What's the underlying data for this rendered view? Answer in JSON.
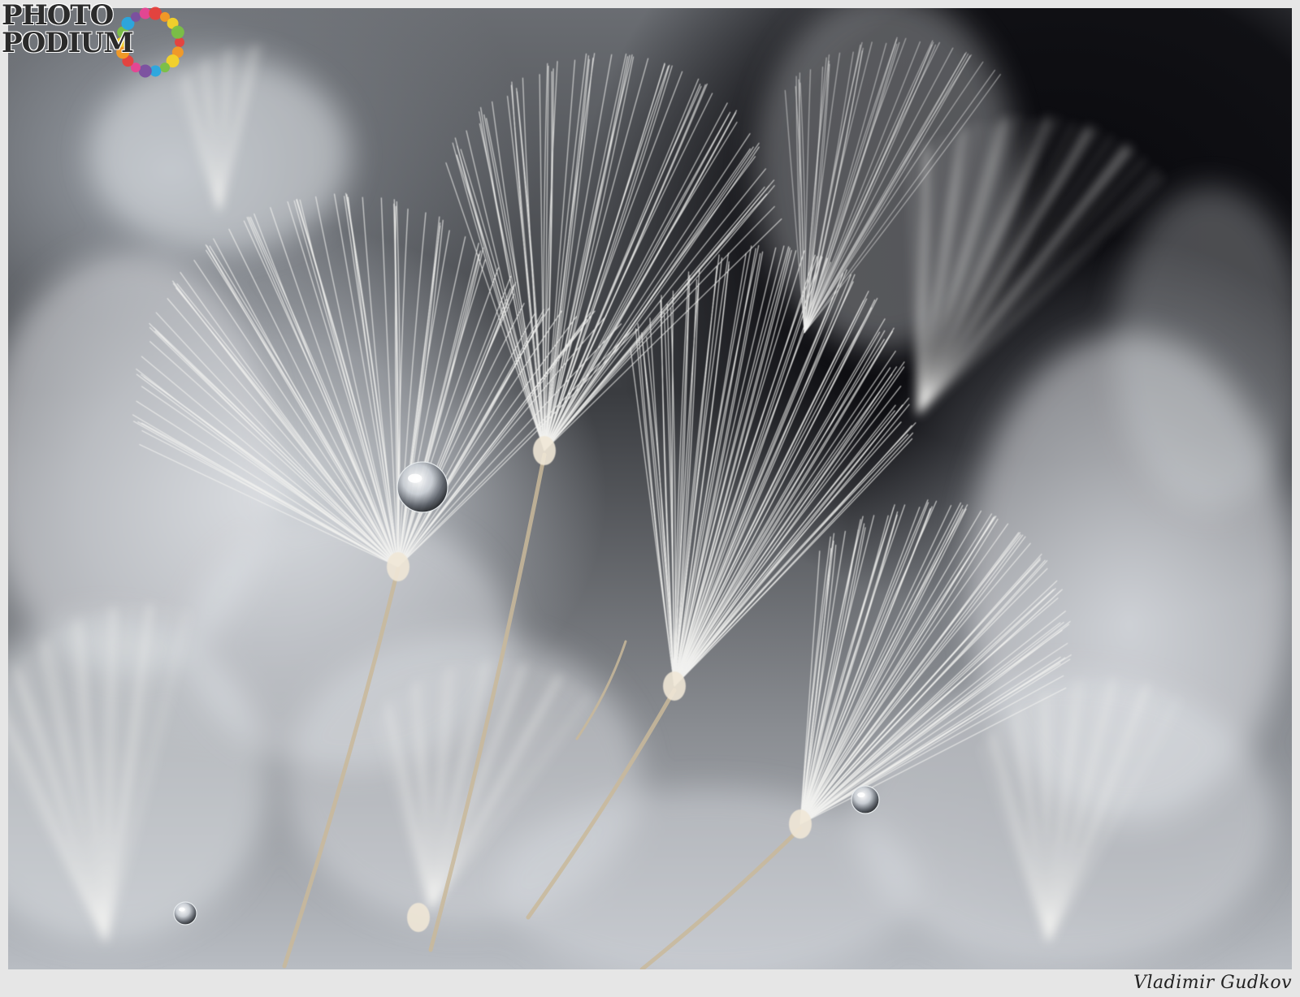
{
  "logo": {
    "line1": "PHOTO",
    "line2": "PODIUM",
    "ring_colors": [
      "#e8403c",
      "#f59a23",
      "#f5d327",
      "#7ac143",
      "#29a8e0",
      "#7b4fa0",
      "#e84393"
    ]
  },
  "signature": "Vladimir Gudkov",
  "colors": {
    "frame": "#e6e6e6",
    "background_dark": "#0c0c10",
    "seed_fiber": "#f2f2f0",
    "stem": "#c9b89a"
  }
}
